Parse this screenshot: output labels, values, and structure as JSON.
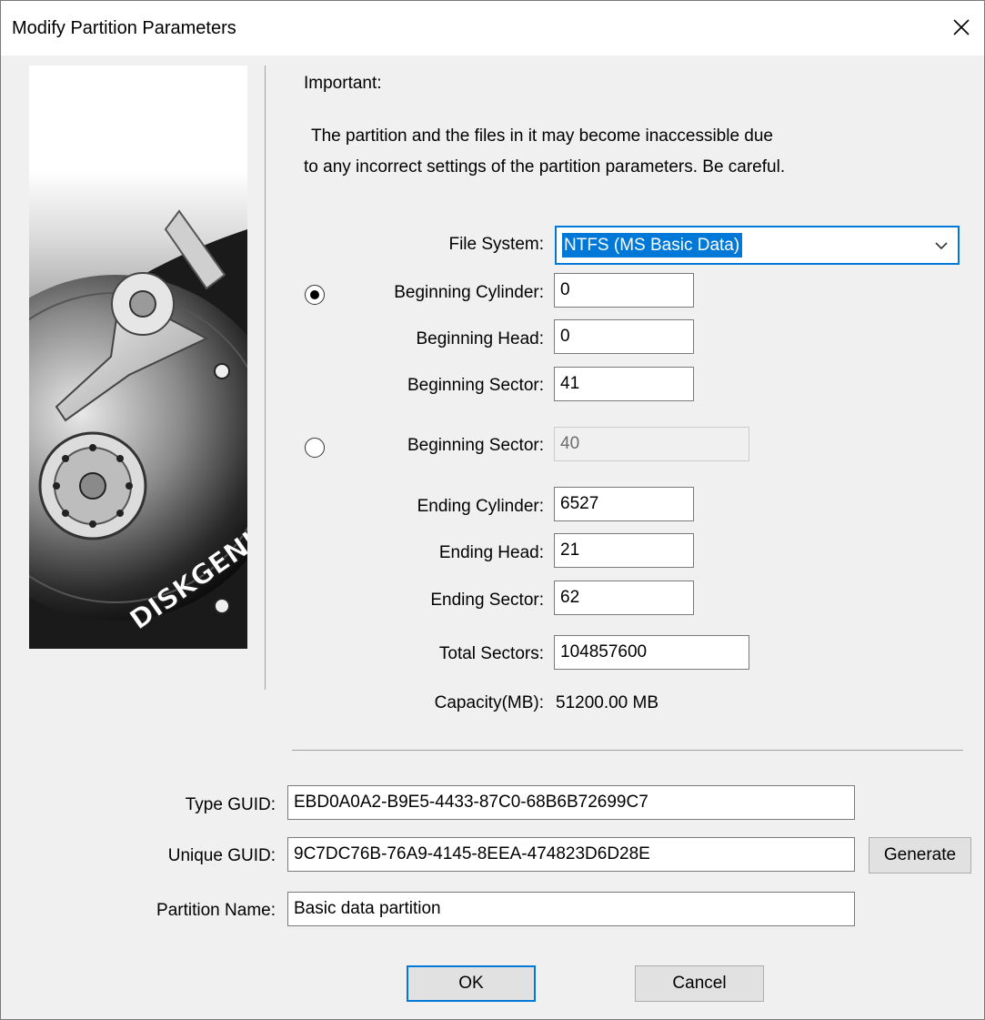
{
  "window": {
    "title": "Modify Partition Parameters"
  },
  "art": {
    "brand": "DISKGENIUS"
  },
  "notice": {
    "heading": "Important:",
    "line1": "The partition and the files in it may become inaccessible due",
    "line2": "to any incorrect settings of the partition parameters. Be careful."
  },
  "file_system": {
    "label": "File System:",
    "value": "NTFS (MS Basic Data)"
  },
  "chs_start": {
    "selected": true,
    "cylinder_label": "Beginning Cylinder:",
    "cylinder": "0",
    "head_label": "Beginning Head:",
    "head": "0",
    "sector_label": "Beginning Sector:",
    "sector": "41"
  },
  "lba_start": {
    "selected": false,
    "label": "Beginning Sector:",
    "value": "40"
  },
  "chs_end": {
    "cylinder_label": "Ending Cylinder:",
    "cylinder": "6527",
    "head_label": "Ending Head:",
    "head": "21",
    "sector_label": "Ending Sector:",
    "sector": "62"
  },
  "total_sectors": {
    "label": "Total Sectors:",
    "value": "104857600"
  },
  "capacity": {
    "label": "Capacity(MB):",
    "value": "51200.00 MB"
  },
  "guid": {
    "type_label": "Type GUID:",
    "type_value": "EBD0A0A2-B9E5-4433-87C0-68B6B72699C7",
    "unique_label": "Unique GUID:",
    "unique_value": "9C7DC76B-76A9-4145-8EEA-474823D6D28E",
    "generate_label": "Generate",
    "name_label": "Partition Name:",
    "name_value": "Basic data partition"
  },
  "buttons": {
    "ok": "OK",
    "cancel": "Cancel"
  },
  "colors": {
    "accent": "#0078d7",
    "dialog_bg": "#f0f0f0"
  },
  "icons": {
    "close": "close-icon",
    "dropdown": "chevron-down-icon"
  }
}
